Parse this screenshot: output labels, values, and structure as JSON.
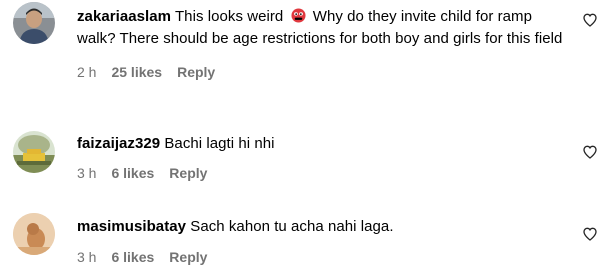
{
  "comments": [
    {
      "username": "zakariaaslam",
      "text_before_emoji": "This looks weird",
      "emoji": "face-with-symbols-emoji",
      "text_after_emoji": "Why do they invite child for ramp walk? There should be age restrictions for both boy and girls for this field",
      "time": "2 h",
      "likes": "25 likes",
      "reply": "Reply"
    },
    {
      "username": "faizaijaz329",
      "text": "Bachi lagti hi nhi",
      "time": "3 h",
      "likes": "6 likes",
      "reply": "Reply"
    },
    {
      "username": "masimusibatay",
      "text": "Sach kahon tu acha nahi laga.",
      "time": "3 h",
      "likes": "6 likes",
      "reply": "Reply"
    }
  ],
  "icons": {
    "like": "heart-outline-icon"
  },
  "colors": {
    "text": "#000000",
    "meta": "#737373",
    "emoji_red": "#e0383e"
  }
}
